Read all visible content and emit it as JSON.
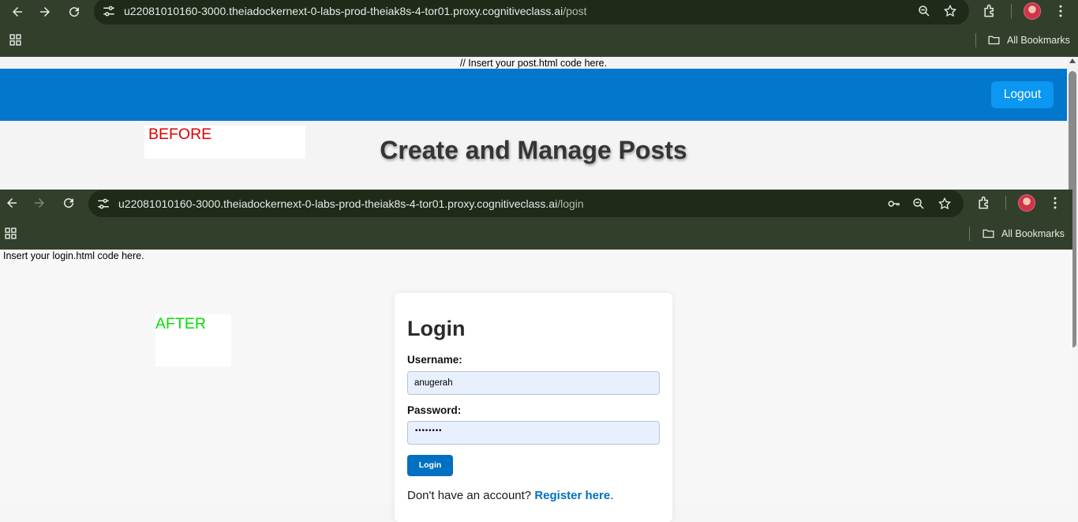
{
  "before_browser": {
    "url_host": "u22081010160-3000.theiadockernext-0-labs-prod-theiak8s-4-tor01.proxy.cognitiveclass.ai",
    "url_path": "/post",
    "bookmarks_label": "All Bookmarks"
  },
  "post_page": {
    "comment_text": "// Insert your post.html code here.",
    "logout_label": "Logout",
    "title": "Create and Manage Posts",
    "header_color": "#0277cc",
    "logout_color": "#0b97f2"
  },
  "annotations": {
    "before_label": "BEFORE",
    "before_color": "#e00000",
    "after_label": "AFTER",
    "after_color": "#00e000"
  },
  "after_browser": {
    "url_host": "u22081010160-3000.theiadockernext-0-labs-prod-theiak8s-4-tor01.proxy.cognitiveclass.ai",
    "url_path": "/login",
    "bookmarks_label": "All Bookmarks"
  },
  "login_page": {
    "comment_text": "Insert your login.html code here.",
    "title": "Login",
    "username_label": "Username:",
    "username_value": "anugerah",
    "password_label": "Password:",
    "password_value": "••••••••",
    "login_button_label": "Login",
    "register_prompt": "Don't have an account?",
    "register_link": "Register here",
    "register_suffix": ".",
    "accent_color": "#0170c2"
  }
}
